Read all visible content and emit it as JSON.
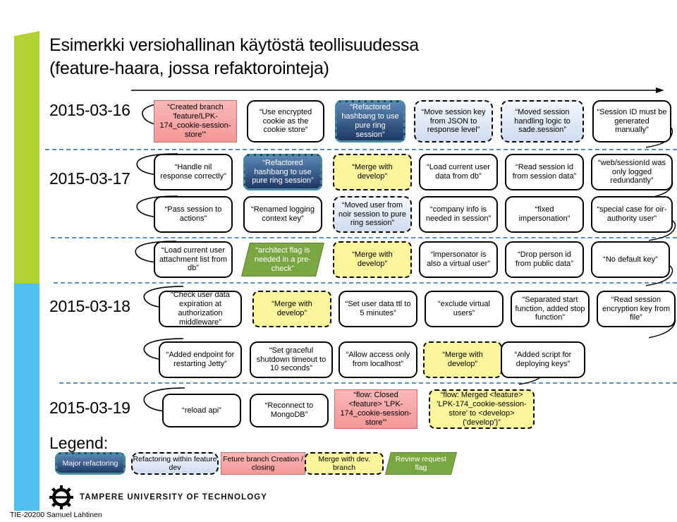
{
  "slide": {
    "title_line1": "Esimerkki versiohallinan käytöstä teollisuudessa",
    "title_line2": "(feature-haara, jossa refaktorointeja)",
    "legend_title": "Legend:"
  },
  "colors": {
    "rail_green": "#b2d233",
    "rail_blue": "#4fc0ef",
    "separator": "#5b8ec4",
    "major_refactoring": "#1f3864",
    "refactoring_feature_dev": "#cfdcef",
    "feature_branch": "#f49797",
    "merge_dev": "#fbf59b",
    "review_flag": "#7aa742"
  },
  "dates": [
    {
      "label": "2015-03-16"
    },
    {
      "label": "2015-03-17"
    },
    {
      "label": "2015-03-18"
    },
    {
      "label": "2015-03-19"
    }
  ],
  "rows": [
    {
      "date": "2015-03-16",
      "nodes": [
        {
          "text": "“Created branch\n'feature/LPK-174_cookie-session-store'”",
          "kind": "pink"
        },
        {
          "text": "“Use encrypted cookie as the cookie store”",
          "kind": "white"
        },
        {
          "text": "“Refactored hashbang to use pure ring session”",
          "kind": "major"
        },
        {
          "text": "“Move session key from JSON to response level”",
          "kind": "lblue"
        },
        {
          "text": "“Moved session handling logic to sade.session”",
          "kind": "lblue"
        },
        {
          "text": "“Session ID must be generated manually”",
          "kind": "white"
        }
      ]
    },
    {
      "date": "2015-03-17",
      "nodes": [
        {
          "text": "“Handle nil response correctly”",
          "kind": "white"
        },
        {
          "text": "“Refactored hashbang to use pure ring session”",
          "kind": "major"
        },
        {
          "text": "“Merge with develop”",
          "kind": "yellow"
        },
        {
          "text": "“Load current user data from db”",
          "kind": "white"
        },
        {
          "text": "“Read session id from session data”",
          "kind": "white"
        },
        {
          "text": "“web/sessionId was only logged redundantly”",
          "kind": "white"
        }
      ]
    },
    {
      "date": "",
      "nodes": [
        {
          "text": "“Pass session to actions”",
          "kind": "white"
        },
        {
          "text": "“Renamed logging context key”",
          "kind": "white"
        },
        {
          "text": "“Moved user from noir session to pure ring session”",
          "kind": "lblue"
        },
        {
          "text": "“company info is needed in session”",
          "kind": "white"
        },
        {
          "text": "“fixed impersonation”",
          "kind": "white"
        },
        {
          "text": "“special case for oir-authority user”",
          "kind": "white"
        }
      ]
    },
    {
      "date": "",
      "nodes": [
        {
          "text": "“Load current user attachment list from db”",
          "kind": "white"
        },
        {
          "text": "“architect flag is needed in a pre-check”",
          "kind": "green"
        },
        {
          "text": "“Merge with develop”",
          "kind": "yellow"
        },
        {
          "text": "“impersonator is also a virtual user”",
          "kind": "white"
        },
        {
          "text": "“Drop person id from public data”",
          "kind": "white"
        },
        {
          "text": "“No default key”",
          "kind": "white"
        }
      ]
    },
    {
      "date": "2015-03-18",
      "nodes": [
        {
          "text": "“Check user data expiration at authorization middleware”",
          "kind": "white"
        },
        {
          "text": "“Merge with develop”",
          "kind": "yellow"
        },
        {
          "text": "“Set user data ttl to 5 minutes”",
          "kind": "white"
        },
        {
          "text": "“exclude virtual users”",
          "kind": "white"
        },
        {
          "text": "“Separated start function, added stop function”",
          "kind": "white"
        },
        {
          "text": "“Read session encryption key from file”",
          "kind": "white"
        }
      ]
    },
    {
      "date": "",
      "nodes": [
        {
          "text": "“Added endpoint for restarting Jetty”",
          "kind": "white"
        },
        {
          "text": "“Set graceful shutdown timeout to 10 seconds”",
          "kind": "white"
        },
        {
          "text": "“Allow access only from localhost”",
          "kind": "white"
        },
        {
          "text": "“Merge with develop”",
          "kind": "yellow"
        },
        {
          "text": "“Added script for deploying keys”",
          "kind": "white"
        }
      ]
    },
    {
      "date": "2015-03-19",
      "nodes": [
        {
          "text": "“reload api”",
          "kind": "white"
        },
        {
          "text": "“Reconnect to MongoDB”",
          "kind": "white"
        },
        {
          "text": "“flow: Closed <feature> 'LPK-174_cookie-session-store'”",
          "kind": "pink"
        },
        {
          "text": "“flow: Merged <feature> 'LPK-174_cookie-session-store' to <develop> ('develop')”",
          "kind": "yellow"
        }
      ]
    }
  ],
  "legend": [
    {
      "text": "Major refactoring",
      "kind": "major"
    },
    {
      "text": "Refactoring within feature dev",
      "kind": "lblue"
    },
    {
      "text": "Feture branch Creation / closing",
      "kind": "pink"
    },
    {
      "text": "Merge with dev. branch",
      "kind": "yellow"
    },
    {
      "text": "Review request flag",
      "kind": "green"
    }
  ],
  "footer": {
    "university": "TAMPERE UNIVERSITY OF TECHNOLOGY",
    "course": "TIE-20200 Samuel Lahtinen"
  }
}
